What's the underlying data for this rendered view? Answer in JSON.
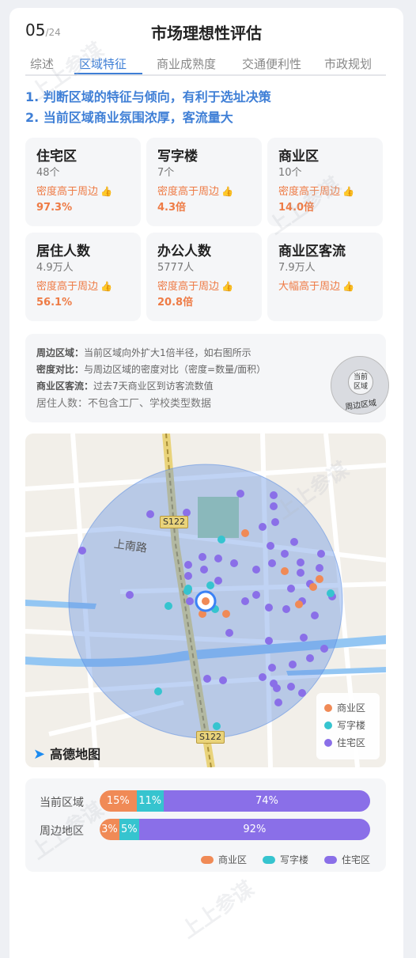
{
  "header": {
    "page": "05",
    "total": "/24",
    "title": "市场理想性评估"
  },
  "tabs": [
    "综述",
    "区域特征",
    "商业成熟度",
    "交通便利性",
    "市政规划"
  ],
  "active_tab": 1,
  "points": [
    "1. 判断区域的特征与倾向，有利于选址决策",
    "2. 当前区域商业氛围浓厚，客流量大"
  ],
  "stats": [
    {
      "title": "住宅区",
      "value": "48个",
      "desc": "密度高于周边",
      "pct": "97.3%"
    },
    {
      "title": "写字楼",
      "value": "7个",
      "desc": "密度高于周边",
      "pct": "4.3倍"
    },
    {
      "title": "商业区",
      "value": "10个",
      "desc": "密度高于周边",
      "pct": "14.0倍"
    },
    {
      "title": "居住人数",
      "value": "4.9万人",
      "desc": "密度高于周边",
      "pct": "56.1%"
    },
    {
      "title": "办公人数",
      "value": "5777人",
      "desc": "密度高于周边",
      "pct": "20.8倍"
    },
    {
      "title": "商业区客流",
      "value": "7.9万人",
      "desc": "大幅高于周边",
      "pct": ""
    }
  ],
  "notes": {
    "n1_label": "周边区域：",
    "n1_text": "当前区域向外扩大1倍半径，如右图所示",
    "n2_label": "密度对比：",
    "n2_text": "与周边区域的密度对比（密度=数量/面积）",
    "n3_label": "商业区客流：",
    "n3_text": "过去7天商业区到访客流数值",
    "n4": "居住人数：不包含工厂、学校类型数据",
    "inner_label_1": "当前",
    "inner_label_2": "区域",
    "outer_label": "周边区域"
  },
  "map": {
    "road_label": "S122",
    "street_label": "上南路",
    "logo": "高德地图",
    "legend": [
      "商业区",
      "写字楼",
      "住宅区"
    ]
  },
  "colors": {
    "commercial": "#f08a56",
    "office": "#36c4cf",
    "residential": "#8a6fe8",
    "accent": "#3f7fd6",
    "highlight": "#ee7b45"
  },
  "distribution": {
    "rows": [
      {
        "label": "当前区域",
        "values": [
          15,
          11,
          74
        ],
        "texts": [
          "15%",
          "11%",
          "74%"
        ]
      },
      {
        "label": "周边地区",
        "values": [
          3,
          5,
          92
        ],
        "texts": [
          "3%",
          "5%",
          "92%"
        ]
      }
    ],
    "legend": [
      "商业区",
      "写字楼",
      "住宅区"
    ]
  },
  "watermark": "上上参谋"
}
